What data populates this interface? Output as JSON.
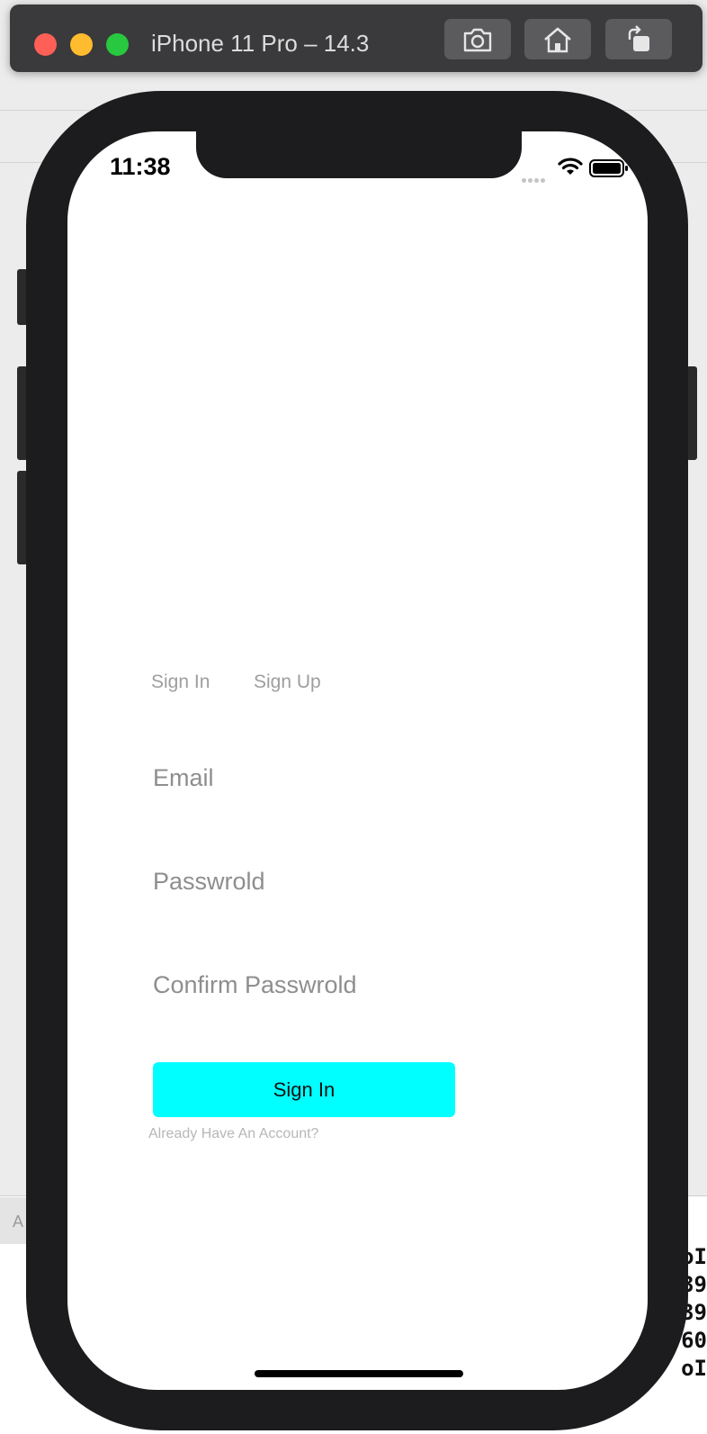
{
  "window": {
    "title": "iPhone 11 Pro – 14.3",
    "toolbar": [
      {
        "icon": "camera-icon"
      },
      {
        "icon": "home-icon"
      },
      {
        "icon": "rotate-icon"
      }
    ]
  },
  "background": {
    "tab_label": "A",
    "console_lines": [
      "oI",
      "39",
      "39",
      "60",
      "oI"
    ]
  },
  "status_bar": {
    "time": "11:38",
    "icons": [
      "signal-icon",
      "wifi-icon",
      "battery-icon"
    ]
  },
  "auth": {
    "tabs": [
      {
        "label": "Sign In"
      },
      {
        "label": "Sign Up"
      }
    ],
    "email": {
      "placeholder": "Email",
      "value": ""
    },
    "password": {
      "placeholder": "Passwrold",
      "value": ""
    },
    "confirm_password": {
      "placeholder": "Confirm Passwrold",
      "value": ""
    },
    "submit_label": "Sign In",
    "submit_color": "#00ffff",
    "account_link": "Already Have An Account?"
  }
}
